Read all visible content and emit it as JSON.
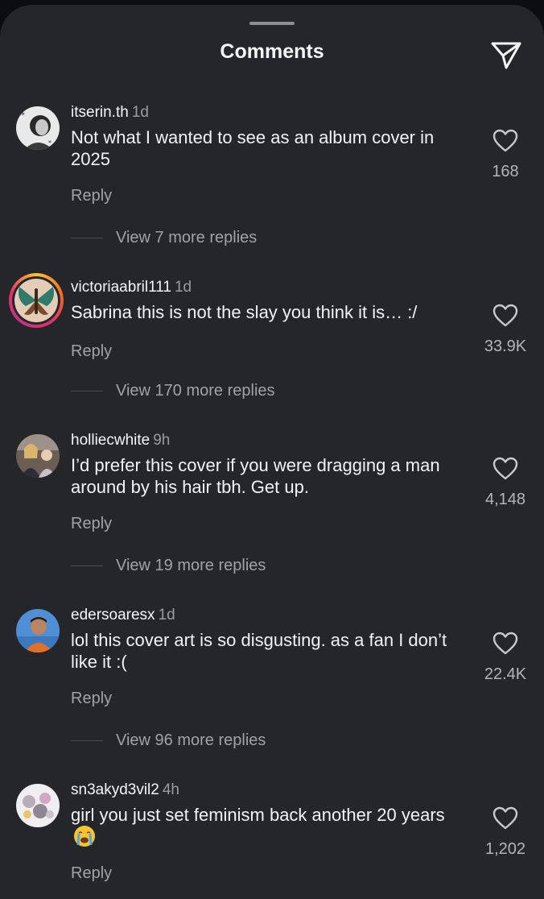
{
  "header": {
    "title": "Comments"
  },
  "icons": {
    "share": "paper-plane-icon",
    "like": "heart-outline-icon",
    "cry_emoji": "loudly-crying-face-emoji"
  },
  "colors": {
    "sheet_bg": "#25262a",
    "page_bg": "#0c0d10",
    "text": "#f5f5f5",
    "muted": "#a1a2a6",
    "story_ring": "#e1306c"
  },
  "comments": [
    {
      "username": "itserin.th",
      "time": "1d",
      "text": "Not what I wanted to see as an album cover in 2025",
      "reply_label": "Reply",
      "view_replies": "View 7 more replies",
      "likes": "168"
    },
    {
      "username": "victoriaabril111",
      "time": "1d",
      "text": "Sabrina this is not the slay you think it is… :/",
      "reply_label": "Reply",
      "view_replies": "View 170 more replies",
      "likes": "33.9K"
    },
    {
      "username": "holliecwhite",
      "time": "9h",
      "text": "I’d prefer this cover if you were dragging a man around by his hair tbh. Get up.",
      "reply_label": "Reply",
      "view_replies": "View 19 more replies",
      "likes": "4,148"
    },
    {
      "username": "edersoaresx",
      "time": "1d",
      "text": "lol this cover art is so disgusting. as a fan I don’t like it :(",
      "reply_label": "Reply",
      "view_replies": "View 96 more replies",
      "likes": "22.4K"
    },
    {
      "username": "sn3akyd3vil2",
      "time": "4h",
      "text": "girl you just set feminism back another 20 years",
      "reply_label": "Reply",
      "likes": "1,202"
    }
  ]
}
